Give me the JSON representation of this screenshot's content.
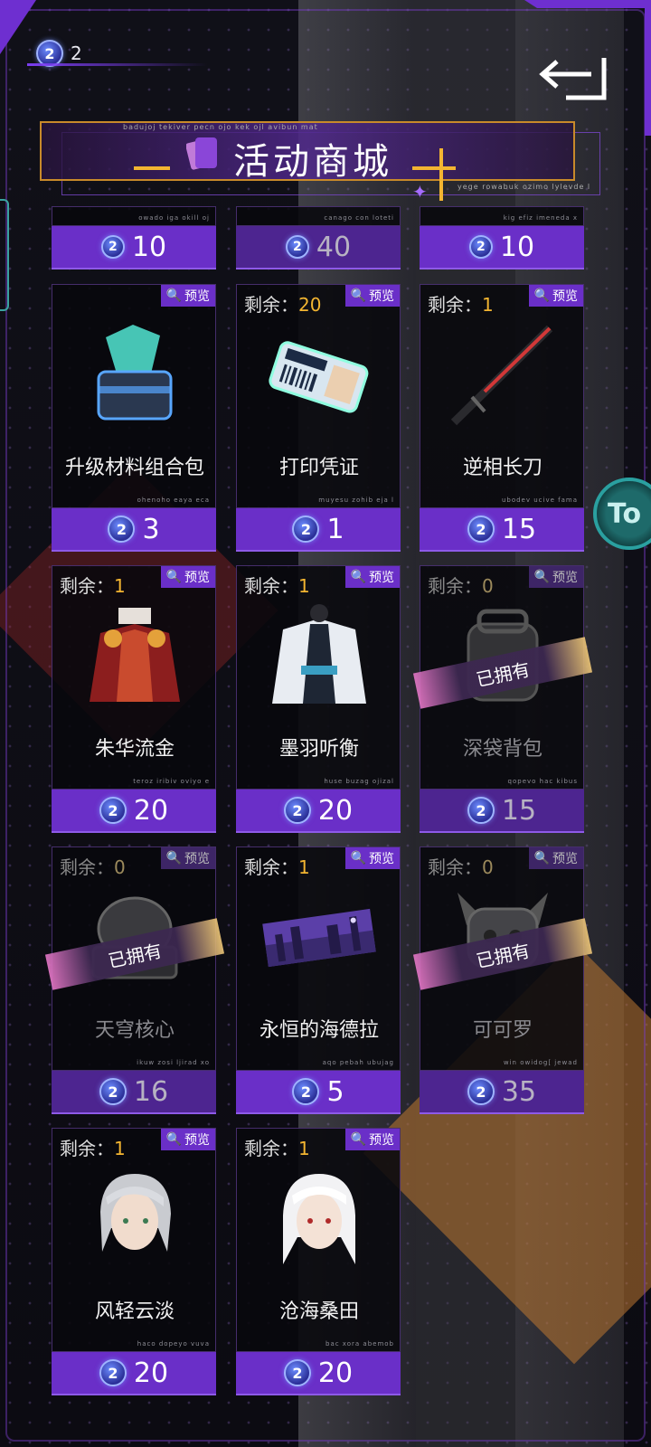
{
  "currency": {
    "amount": "2",
    "coin_symbol": "2"
  },
  "title": "活动商城",
  "title_tiny_top": "badujoj tekiver pecn ojo kek ojl avibun mat",
  "title_tiny_bottom": "yege rowabuk ozimo lylevde l",
  "side_badge": "To",
  "labels": {
    "remain": "剩余：",
    "preview": "预览",
    "owned": "已拥有"
  },
  "colors": {
    "accent_purple": "#6a2fc8",
    "gold": "#f3b531",
    "orange_diamond": "#be7832"
  },
  "top_row": [
    {
      "price": "10",
      "tiny": "owado iga okill oj"
    },
    {
      "price": "40",
      "tiny": "canago con loteti"
    },
    {
      "price": "10",
      "tiny": "kig efiz imeneda x"
    }
  ],
  "items": [
    {
      "name": "升级材料组合包",
      "remain": null,
      "price": "3",
      "owned": false,
      "tiny": "ohenoho eaya eca",
      "icon": "material-chest-icon"
    },
    {
      "name": "打印凭证",
      "remain": "20",
      "price": "1",
      "owned": false,
      "tiny": "muyesu zohib eja l",
      "icon": "ticket-icon"
    },
    {
      "name": "逆相长刀",
      "remain": "1",
      "price": "15",
      "owned": false,
      "tiny": "ubodev ucive fama",
      "icon": "long-blade-icon"
    },
    {
      "name": "朱华流金",
      "remain": "1",
      "price": "20",
      "owned": false,
      "tiny": "teroz iribiv oviyo e",
      "icon": "red-outfit-icon"
    },
    {
      "name": "墨羽听衡",
      "remain": "1",
      "price": "20",
      "owned": false,
      "tiny": "huse buzag ojizal",
      "icon": "white-robe-icon"
    },
    {
      "name": "深袋背包",
      "remain": "0",
      "price": "15",
      "owned": true,
      "tiny": "qopevo hac kibus",
      "icon": "backpack-icon"
    },
    {
      "name": "天穹核心",
      "remain": "0",
      "price": "16",
      "owned": true,
      "tiny": "ikuw zosi ljirad xo",
      "icon": "core-helmet-icon"
    },
    {
      "name": "永恒的海德拉",
      "remain": "1",
      "price": "5",
      "owned": false,
      "tiny": "aqo pebah ubujag",
      "icon": "city-banner-icon"
    },
    {
      "name": "可可罗",
      "remain": "0",
      "price": "35",
      "owned": true,
      "tiny": "win owidog[ jewad",
      "icon": "robot-pet-icon"
    },
    {
      "name": "风轻云淡",
      "remain": "1",
      "price": "20",
      "owned": false,
      "tiny": "haco dopeyo vuva",
      "icon": "silver-hair-avatar-icon"
    },
    {
      "name": "沧海桑田",
      "remain": "1",
      "price": "20",
      "owned": false,
      "tiny": "bac xora abemob",
      "icon": "white-hair-avatar-icon"
    }
  ]
}
